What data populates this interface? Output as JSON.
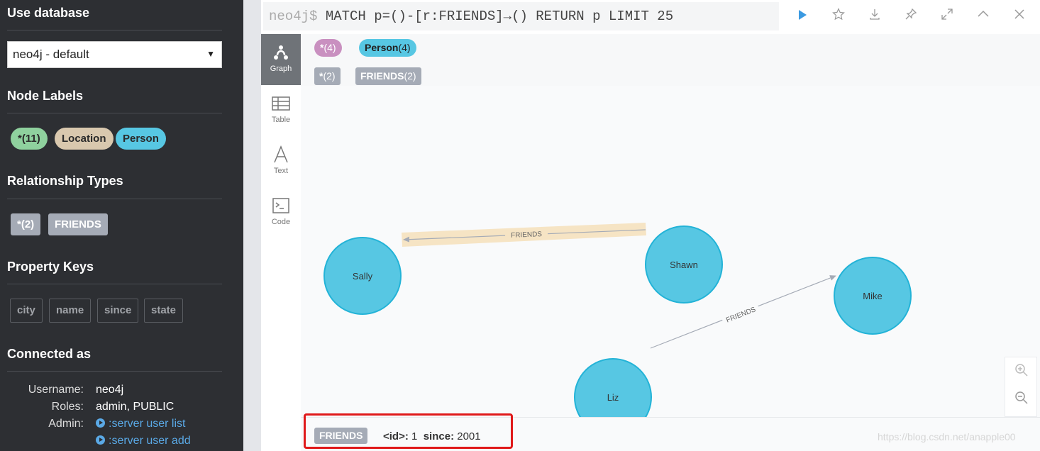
{
  "sidebar": {
    "use_database_title": "Use database",
    "database_select_value": "neo4j - default",
    "node_labels_title": "Node Labels",
    "node_labels": [
      {
        "label": "*(11)",
        "color": "#8fd19e"
      },
      {
        "label": "Location",
        "color": "#d9c8ae"
      },
      {
        "label": "Person",
        "color": "#57c7e3"
      }
    ],
    "relationship_types_title": "Relationship Types",
    "relationship_types": [
      "*(2)",
      "FRIENDS"
    ],
    "property_keys_title": "Property Keys",
    "property_keys": [
      "city",
      "name",
      "since",
      "state"
    ],
    "connected_as_title": "Connected as",
    "username_label": "Username:",
    "username_value": "neo4j",
    "roles_label": "Roles:",
    "roles_value": "admin, PUBLIC",
    "admin_label": "Admin:",
    "admin_links": [
      ":server user list",
      ":server user add"
    ]
  },
  "editor": {
    "prompt": "neo4j$",
    "query": " MATCH p=()-[r:FRIENDS]→() RETURN p LIMIT 25",
    "toolbar_icons": [
      "play-icon",
      "star-icon",
      "download-icon",
      "pin-icon",
      "expand-icon",
      "collapse-icon",
      "close-icon"
    ]
  },
  "views": [
    {
      "label": "Graph",
      "icon": "graph-icon"
    },
    {
      "label": "Table",
      "icon": "table-icon"
    },
    {
      "label": "Text",
      "icon": "text-icon"
    },
    {
      "label": "Code",
      "icon": "code-icon"
    }
  ],
  "legend": {
    "node_all": {
      "label": "*",
      "count": "(4)",
      "color": "#c990c0"
    },
    "node_person": {
      "label": "Person",
      "count": "(4)",
      "color": "#57c7e3"
    },
    "rel_all": {
      "label": "*",
      "count": "(2)"
    },
    "rel_friends": {
      "label": "FRIENDS",
      "count": "(2)"
    }
  },
  "graph": {
    "nodes": [
      {
        "name": "Sally"
      },
      {
        "name": "Shawn"
      },
      {
        "name": "Mike"
      },
      {
        "name": "Liz"
      }
    ],
    "relationships": [
      {
        "from": "Shawn",
        "to": "Sally",
        "type": "FRIENDS",
        "selected": true
      },
      {
        "from": "Liz",
        "to": "Mike",
        "type": "FRIENDS",
        "selected": false
      }
    ],
    "node_color": "#57c7e3",
    "node_border": "#23b3d7",
    "selected_highlight": "#f6e4c4"
  },
  "status": {
    "type_tag": "FRIENDS",
    "id_key": "<id>:",
    "id_value": "1",
    "since_key": "since:",
    "since_value": "2001"
  },
  "zoom": {
    "in_icon": "zoom-in-icon",
    "out_icon": "zoom-out-icon"
  },
  "watermark": "https://blog.csdn.net/anapple00"
}
